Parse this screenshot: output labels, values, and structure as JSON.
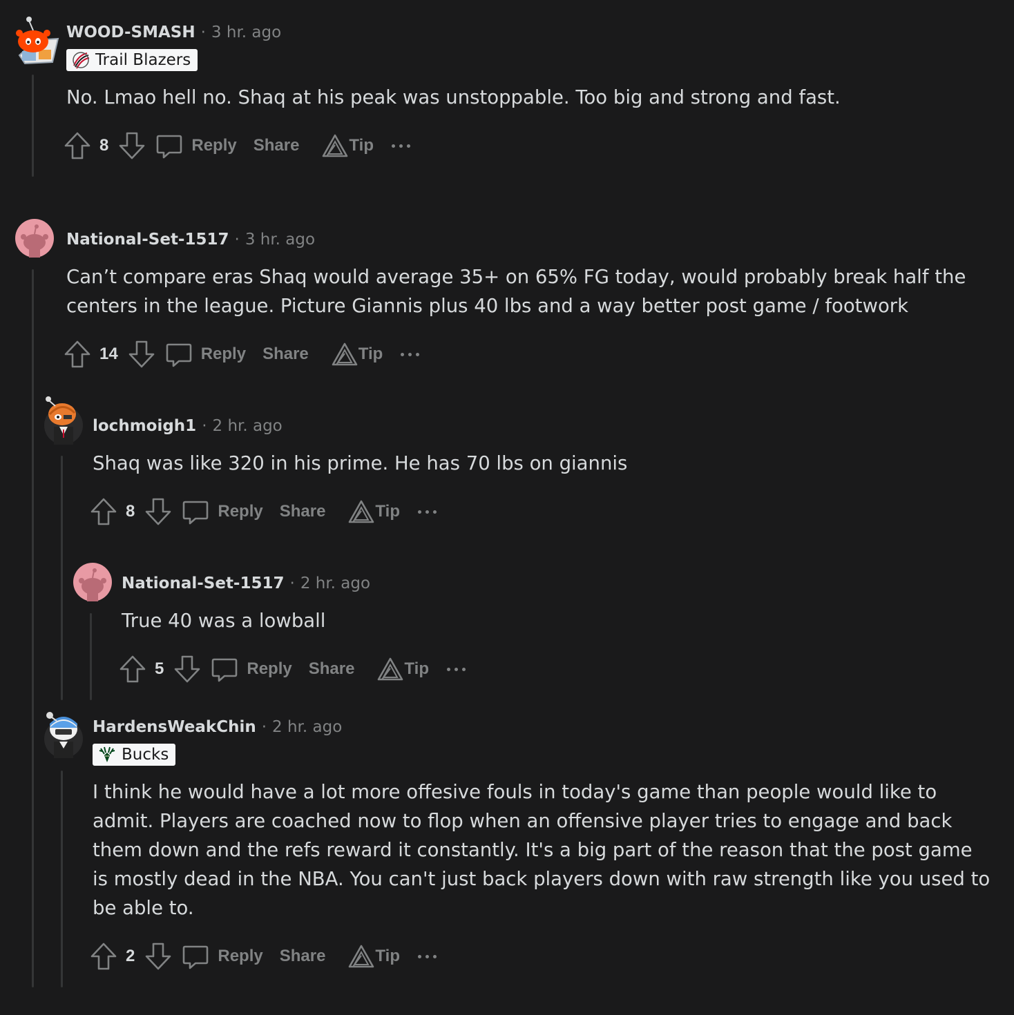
{
  "comments": [
    {
      "username": "WOOD-SMASH",
      "separator": "·",
      "time": "3 hr. ago",
      "flair": "Trail Blazers",
      "flair_icon": "trail-blazers-logo",
      "body": [
        "No. Lmao hell no. Shaq at his peak was unstoppable. Too big and strong and fast."
      ],
      "votes": "8",
      "reply": "Reply",
      "share": "Share",
      "tip": "Tip"
    },
    {
      "username": "National-Set-1517",
      "separator": "·",
      "time": "3 hr. ago",
      "body": [
        "Can’t compare eras Shaq would average 35+ on 65% FG today, would probably break half the",
        "centers in the league. Picture Giannis plus 40 lbs and a way better post game / footwork"
      ],
      "votes": "14",
      "reply": "Reply",
      "share": "Share",
      "tip": "Tip"
    },
    {
      "username": "lochmoigh1",
      "separator": "·",
      "time": "2 hr. ago",
      "body": [
        "Shaq was like 320 in his prime. He has 70 lbs on giannis"
      ],
      "votes": "8",
      "reply": "Reply",
      "share": "Share",
      "tip": "Tip"
    },
    {
      "username": "National-Set-1517",
      "separator": "·",
      "time": "2 hr. ago",
      "body": [
        "True 40 was a lowball"
      ],
      "votes": "5",
      "reply": "Reply",
      "share": "Share",
      "tip": "Tip"
    },
    {
      "username": "HardensWeakChin",
      "separator": "·",
      "time": "2 hr. ago",
      "flair": "Bucks",
      "flair_icon": "bucks-logo",
      "body": [
        "I think he would have a lot more offesive fouls in today's game than people would like to",
        "admit. Players are coached now to flop when an offensive player tries to engage and back",
        "them down and the refs reward it constantly. It's a big part of the reason that the post game",
        "is mostly dead in the NBA. You can't just back players down with raw strength like you used to",
        "be able to."
      ],
      "votes": "2",
      "reply": "Reply",
      "share": "Share",
      "tip": "Tip"
    }
  ],
  "colors": {
    "background": "#1a1a1b",
    "text": "#d7dadc",
    "muted": "#818384",
    "thread_line": "#343536",
    "flair_bg": "#f6f7f8"
  }
}
